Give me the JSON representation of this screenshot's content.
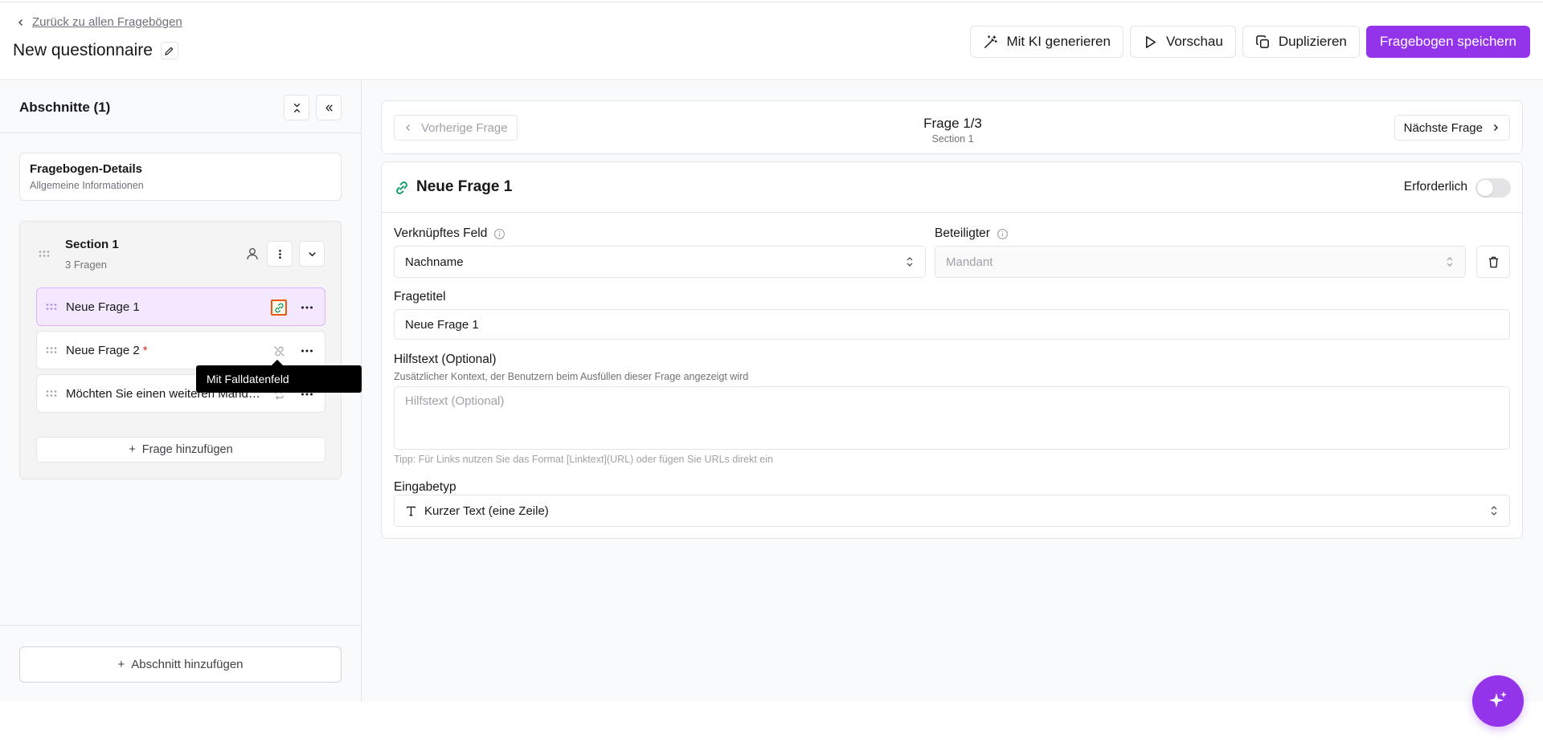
{
  "header": {
    "back_label": "Zurück zu allen Fragebögen",
    "title": "New questionnaire",
    "actions": {
      "ai_label": "Mit KI generieren",
      "preview_label": "Vorschau",
      "duplicate_label": "Duplizieren",
      "save_label": "Fragebogen speichern"
    }
  },
  "sidebar": {
    "title": "Abschnitte (1)",
    "details": {
      "title": "Fragebogen-Details",
      "subtitle": "Allgemeine Informationen"
    },
    "section": {
      "title": "Section 1",
      "count": "3 Fragen",
      "questions": [
        {
          "label": "Neue Frage 1",
          "required": false,
          "active": true,
          "icon": "link-icon"
        },
        {
          "label": "Neue Frage 2",
          "required": true,
          "active": false,
          "icon": "unlink-icon"
        },
        {
          "label": "Möchten Sie einen weiteren Mandanten hinzufügen?",
          "required": false,
          "active": false,
          "icon": "repeat-icon"
        }
      ],
      "required_marker": "*",
      "add_question_label": "Frage hinzufügen"
    },
    "tooltip": "Mit Falldatenfeld",
    "add_section_label": "Abschnitt hinzufügen"
  },
  "main": {
    "nav": {
      "prev_label": "Vorherige Frage",
      "next_label": "Nächste Frage",
      "position": "Frage 1/3",
      "section": "Section 1"
    },
    "question": {
      "title": "Neue Frage 1",
      "required_label": "Erforderlich",
      "required_on": false,
      "linked_field_label": "Verknüpftes Feld",
      "linked_field_value": "Nachname",
      "participant_label": "Beteiligter",
      "participant_value": "Mandant",
      "title_label": "Fragetitel",
      "title_value": "Neue Frage 1",
      "help_label": "Hilfstext (Optional)",
      "help_sub": "Zusätzlicher Kontext, der Benutzern beim Ausfüllen dieser Frage angezeigt wird",
      "help_placeholder": "Hilfstext (Optional)",
      "tip": "Tipp: Für Links nutzen Sie das Format [Linktext](URL) oder fügen Sie URLs direkt ein",
      "input_type_label": "Eingabetyp",
      "input_type_value": "Kurzer Text (eine Zeile)"
    }
  },
  "colors": {
    "accent": "#9333ea",
    "active_bg": "#f3e8ff",
    "link_green": "#059669",
    "required": "#dc2626"
  }
}
